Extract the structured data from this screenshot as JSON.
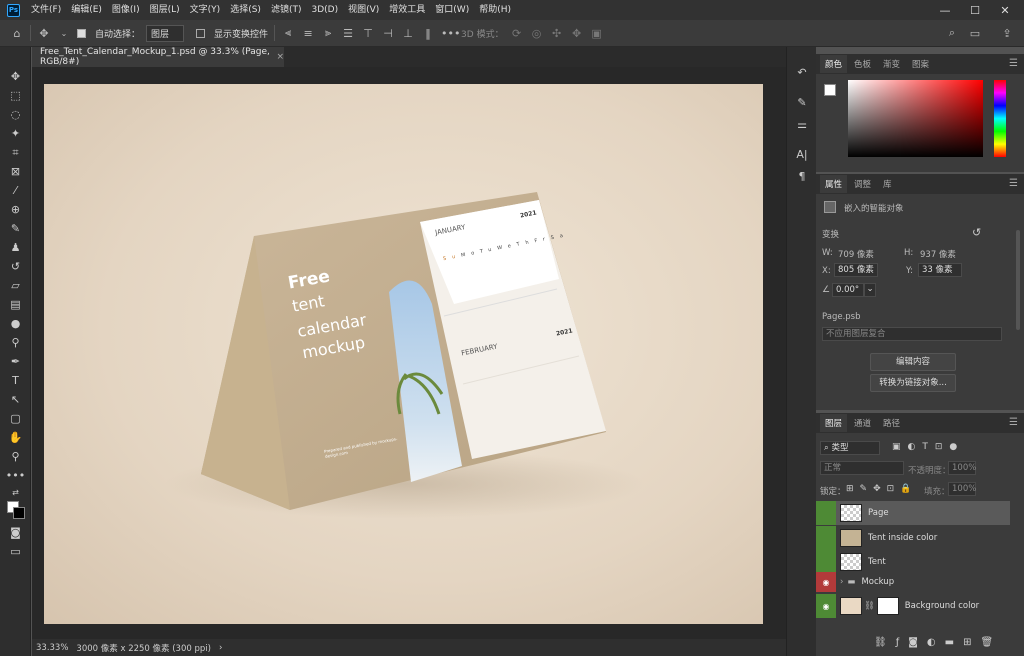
{
  "menubar": {
    "app_logo": "Ps",
    "items": [
      "文件(F)",
      "编辑(E)",
      "图像(I)",
      "图层(L)",
      "文字(Y)",
      "选择(S)",
      "滤镜(T)",
      "3D(D)",
      "视图(V)",
      "增效工具",
      "窗口(W)",
      "帮助(H)"
    ]
  },
  "window_controls": {
    "minimize": "—",
    "maximize": "☐",
    "close": "✕"
  },
  "options": {
    "auto_select_label": "自动选择：",
    "auto_select_value": "图层",
    "show_transform_label": "显示变换控件",
    "mode_3d_label": "3D 模式："
  },
  "document": {
    "tab_title": "Free_Tent_Calendar_Mockup_1.psd @ 33.3% (Page, RGB/8#)",
    "close": "×"
  },
  "mockup": {
    "heading": "Free",
    "lines": [
      "tent",
      "calendar",
      "mockup"
    ],
    "credit": "Prepared and published by mockups-design.com",
    "jan": {
      "month": "JANUARY",
      "year": "2021"
    },
    "feb": {
      "month": "FEBRUARY",
      "year": "2021"
    },
    "weekdays": [
      "Su",
      "Mo",
      "Tu",
      "We",
      "Th",
      "Fr",
      "Sa"
    ]
  },
  "status": {
    "zoom": "33.33%",
    "size": "3000 像素 x 2250 像素 (300 ppi)"
  },
  "color_panel": {
    "tabs": [
      "颜色",
      "色板",
      "渐变",
      "图案"
    ]
  },
  "properties": {
    "tabs": [
      "属性",
      "调整",
      "库"
    ],
    "type_label": "嵌入的智能对象",
    "transform_label": "变换",
    "w_label": "W:",
    "w_value": "709 像素",
    "h_label": "H:",
    "h_value": "937 像素",
    "x_label": "X:",
    "x_value": "805 像素",
    "y_label": "Y:",
    "y_value": "33 像素",
    "angle_value": "0.00°",
    "file_name": "Page.psb",
    "comp_placeholder": "不应用图层复合",
    "edit_button": "编辑内容",
    "convert_button": "转换为链接对象..."
  },
  "layers_panel": {
    "tabs": [
      "图层",
      "通道",
      "路径"
    ],
    "filter_label": "类型",
    "blend_mode": "正常",
    "opacity_label": "不透明度：",
    "opacity_value": "100%",
    "lock_label": "锁定：",
    "fill_label": "填充：",
    "fill_value": "100%",
    "layers": [
      {
        "name": "Page"
      },
      {
        "name": "Tent inside color"
      },
      {
        "name": "Tent"
      },
      {
        "name": "Mockup"
      },
      {
        "name": "Background color"
      }
    ]
  }
}
